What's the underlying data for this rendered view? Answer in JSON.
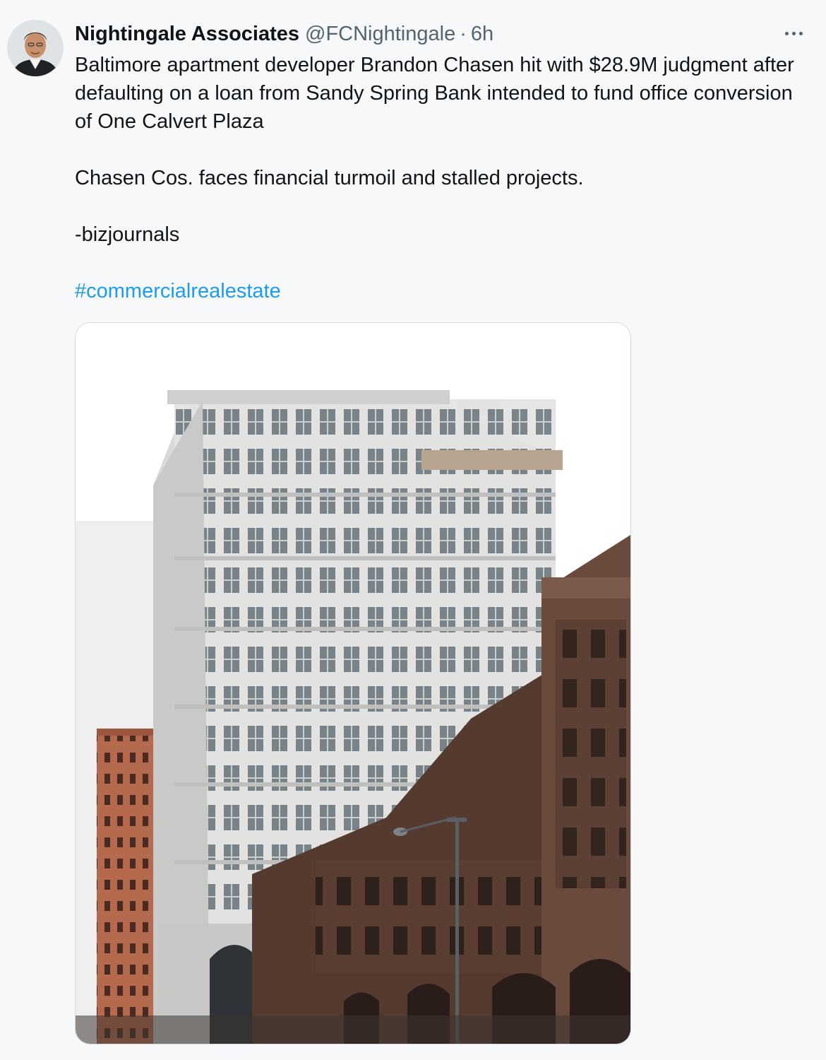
{
  "tweet": {
    "author": {
      "display_name": "Nightingale Associates",
      "handle": "@FCNightingale",
      "separator": "·",
      "time": "6h"
    },
    "more_icon": "more-horizontal-icon",
    "text": {
      "line1": "Baltimore apartment developer Brandon Chasen hit with $28.9M judgment after defaulting on a loan from Sandy Spring Bank intended to fund office conversion of One Calvert Plaza",
      "line2": "Chasen Cos. faces financial turmoil and stalled projects.",
      "line3": "-bizjournals",
      "hashtag": "#commercialrealestate"
    },
    "colors": {
      "link": "#1d9bf0",
      "secondary_text": "#536471",
      "background": "#f7f8f9"
    }
  }
}
